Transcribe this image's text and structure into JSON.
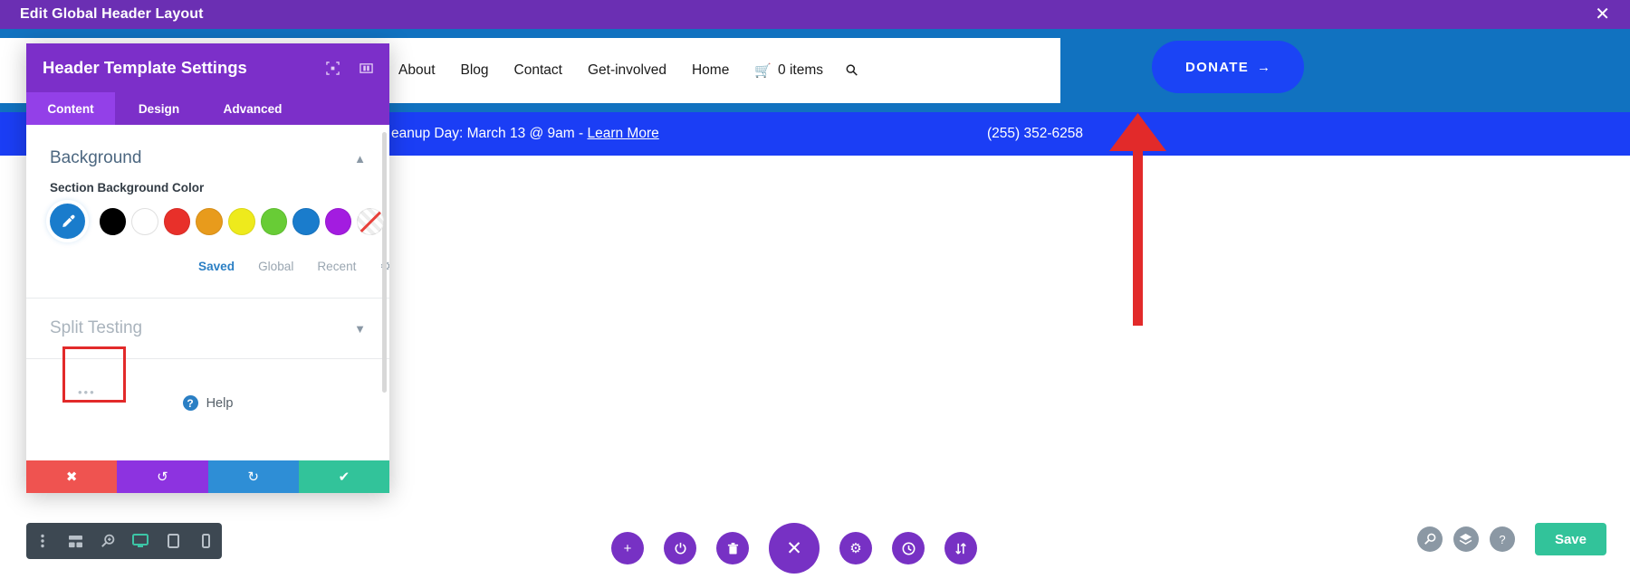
{
  "admin_bar": {
    "title": "Edit Global Header Layout",
    "close_icon": "close-icon",
    "background": "#6b2fb3"
  },
  "site": {
    "nav": [
      {
        "label": "About"
      },
      {
        "label": "Blog"
      },
      {
        "label": "Contact"
      },
      {
        "label": "Get-involved"
      },
      {
        "label": "Home"
      }
    ],
    "cart": {
      "icon": "shopping-cart-icon",
      "label": "0 items"
    },
    "search_icon": "search-icon",
    "donate": {
      "label": "DONATE",
      "arrow": "→",
      "color": "#1b44f5"
    },
    "announcement": {
      "text": "eanup Day: March 13 @ 9am - ",
      "link": "Learn More",
      "phone": "(255) 352-6258",
      "background": "#1b3ef5"
    },
    "header_background": "#1172c0"
  },
  "panel": {
    "title": "Header Template Settings",
    "header_icons": [
      "expand-icon",
      "layout-columns-icon"
    ],
    "header_color": "#7c2fc9",
    "tabs": [
      {
        "label": "Content",
        "active": true
      },
      {
        "label": "Design",
        "active": false
      },
      {
        "label": "Advanced",
        "active": false
      }
    ],
    "sections": {
      "background": {
        "title": "Background",
        "chevron": "chevron-up-icon",
        "field_label": "Section Background Color",
        "picker_icon": "eyedropper-icon",
        "more_dots": "•••",
        "swatches": [
          "#000000",
          "#ffffff",
          "#e8302a",
          "#e89b1c",
          "#eeea1c",
          "#68cc36",
          "#1a7ccc",
          "#a31ce0"
        ],
        "transparent_swatch": "transparent-swatch",
        "palette_tabs": [
          {
            "label": "Saved",
            "active": true
          },
          {
            "label": "Global",
            "active": false
          },
          {
            "label": "Recent",
            "active": false
          }
        ],
        "gear_icon": "gear-icon"
      },
      "split_testing": {
        "title": "Split Testing",
        "chevron": "chevron-down-icon"
      }
    },
    "help": {
      "icon": "question-circle-icon",
      "label": "Help"
    },
    "footer_buttons": [
      {
        "name": "cancel",
        "icon": "✖",
        "color": "#ef5350"
      },
      {
        "name": "undo",
        "icon": "↺",
        "color": "#8d33e0"
      },
      {
        "name": "redo",
        "icon": "↻",
        "color": "#2e8ed6"
      },
      {
        "name": "save",
        "icon": "✔",
        "color": "#32c39a"
      }
    ]
  },
  "device_toolbar": {
    "items": [
      {
        "icon": "more-vertical-icon",
        "active": false
      },
      {
        "icon": "wireframe-icon",
        "active": false
      },
      {
        "icon": "zoom-icon",
        "active": false
      },
      {
        "icon": "desktop-icon",
        "active": true
      },
      {
        "icon": "tablet-icon",
        "active": false
      },
      {
        "icon": "mobile-icon",
        "active": false
      }
    ],
    "active_color": "#3cc5a6",
    "background": "#3d4852"
  },
  "round_toolbar": {
    "color": "#7731c4",
    "items": [
      {
        "icon": "plus-icon",
        "big": false
      },
      {
        "icon": "power-icon",
        "big": false
      },
      {
        "icon": "trash-icon",
        "big": false
      },
      {
        "icon": "close-x-icon",
        "big": true
      },
      {
        "icon": "gear-icon",
        "big": false
      },
      {
        "icon": "history-clock-icon",
        "big": false
      },
      {
        "icon": "sort-arrows-icon",
        "big": false
      }
    ]
  },
  "right_controls": {
    "icons": [
      "search-zoom-icon",
      "layers-icon",
      "help-question-icon"
    ],
    "save_label": "Save",
    "save_color": "#32c39a"
  },
  "annotation": {
    "arrow_color": "#e22a2a",
    "highlight_color": "#e22a2a"
  }
}
